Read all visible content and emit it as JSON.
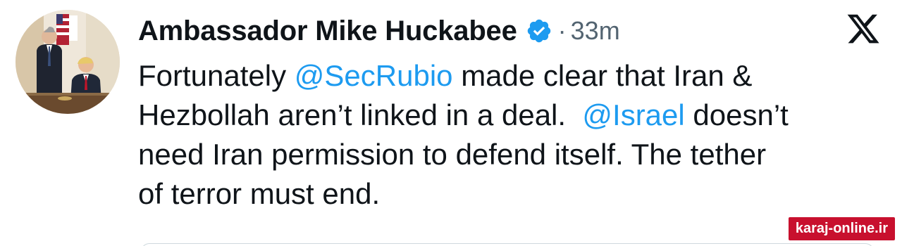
{
  "tweet": {
    "author_name": "Ambassador Mike Huckabee",
    "separator": "·",
    "timestamp": "33m",
    "lines": [
      {
        "before": "Fortunately ",
        "mention": "@SecRubio",
        "after": " made clear that Iran &"
      },
      {
        "before": "Hezbollah aren’t linked in a deal.  ",
        "mention": "@Israel",
        "after": " doesn’t"
      },
      {
        "text": "need Iran permission to defend itself. The tether"
      },
      {
        "text": "of terror must end."
      }
    ]
  },
  "icons": {
    "verified": "verified-badge-icon",
    "platform": "x-logo-icon"
  },
  "watermark": {
    "text": "karaj-online.ir"
  },
  "colors": {
    "text": "#0f1419",
    "secondary": "#536471",
    "mention": "#1d9bf0",
    "verified": "#1d9bf0",
    "watermark_bg": "#c8102e"
  }
}
